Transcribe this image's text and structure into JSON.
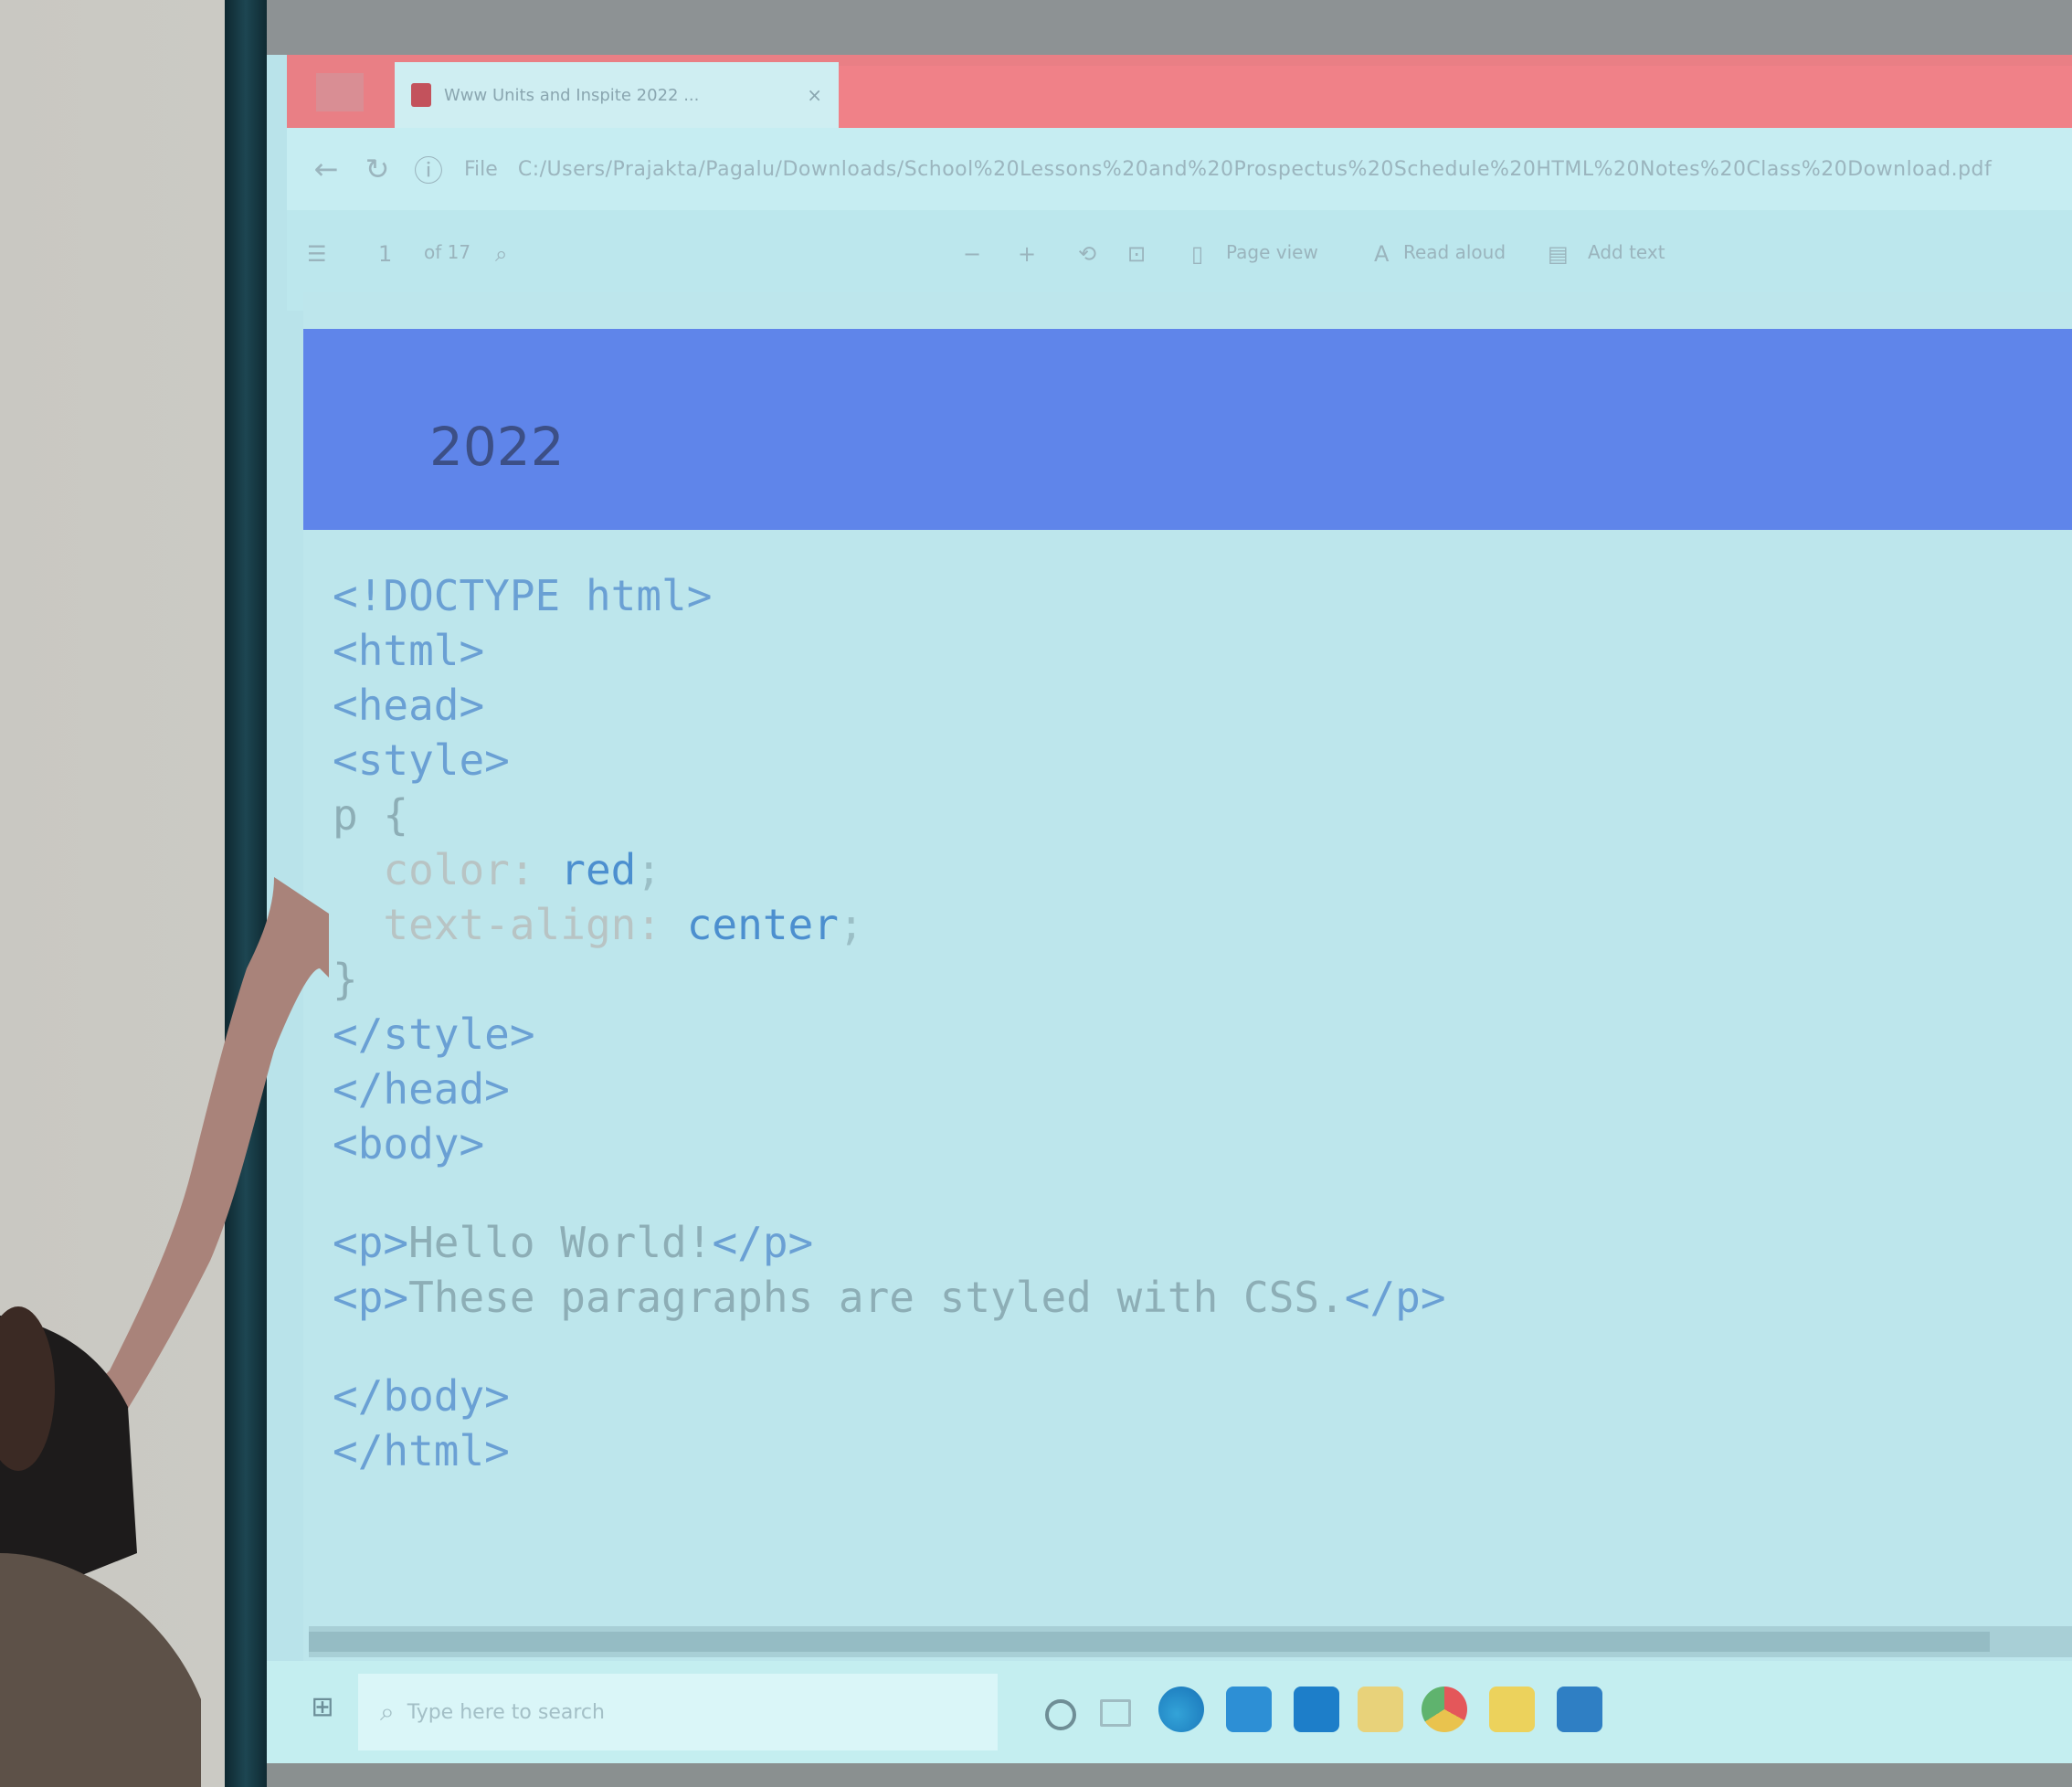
{
  "browser": {
    "tab_title": "Www Units and Inspite 2022 ...",
    "tab_close": "×",
    "address_info": "File",
    "address_url": "C:/Users/Prajakta/Pagalu/Downloads/School%20Lessons%20and%20Prospectus%20Schedule%20HTML%20Notes%20Class%20Download.pdf"
  },
  "pdf_toolbar": {
    "page_current": "1",
    "page_total": "of 17",
    "zoom_out": "−",
    "zoom_in": "+",
    "page_view": "Page view",
    "read_aloud": "Read aloud",
    "add_text": "Add text"
  },
  "document": {
    "header_year": "2022",
    "code_lines": [
      "<!DOCTYPE html>",
      "<html>",
      "<head>",
      "<style>",
      "p {",
      "  color: red;",
      "  text-align: center;",
      "}",
      "</style>",
      "</head>",
      "<body>",
      "",
      "<p>Hello World!</p>",
      "<p>These paragraphs are styled with CSS.</p>",
      "",
      "</body>",
      "</html>"
    ]
  },
  "taskbar": {
    "search_placeholder": "Type here to search"
  },
  "colors": {
    "tab_bar": "#e97f85",
    "header_band": "#5f85ea",
    "page_bg": "#bde6ec",
    "code_tag": "#6aa0d4",
    "code_value": "#4c8fcf"
  },
  "icons": {
    "tab": "pdf-icon",
    "nav": [
      "back-icon",
      "refresh-icon",
      "info-icon"
    ],
    "toolbar": [
      "contents-icon",
      "search-icon",
      "rotate-icon",
      "fit-page-icon",
      "page-view-icon",
      "read-aloud-icon",
      "add-text-icon"
    ],
    "taskbar": [
      "windows-start-icon",
      "search-icon",
      "cortana-icon",
      "task-view-icon",
      "edge-icon",
      "store-icon",
      "outlook-icon",
      "file-explorer-icon",
      "chrome-icon",
      "sticky-notes-icon",
      "app-icon"
    ]
  }
}
